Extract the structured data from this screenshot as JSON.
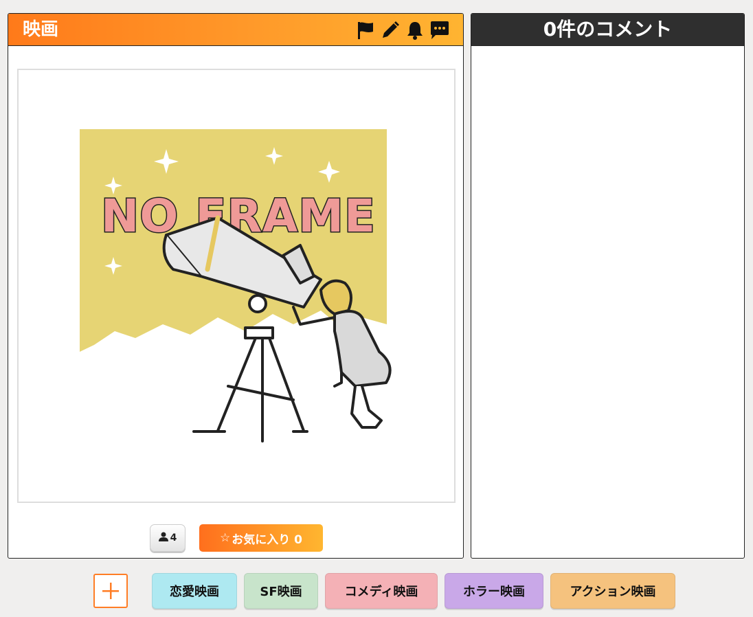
{
  "main": {
    "title": "映画",
    "icons": [
      "flag-icon",
      "pencil-icon",
      "bell-icon",
      "comment-icon"
    ],
    "image": {
      "text": "NO FRAME"
    },
    "viewers": {
      "icon": "user-icon",
      "count": "4"
    },
    "favorite": {
      "star": "☆",
      "label": "お気に入り 0"
    }
  },
  "comments": {
    "title": "0件のコメント"
  },
  "categories": [
    {
      "label": "恋愛映画",
      "color": "#aee9f1"
    },
    {
      "label": "SF映画",
      "color": "#c8e4cb"
    },
    {
      "label": "コメディ映画",
      "color": "#f4b1b6"
    },
    {
      "label": "ホラー映画",
      "color": "#c9a8e8"
    },
    {
      "label": "アクション映画",
      "color": "#f5c27e"
    }
  ],
  "colors": {
    "accent": "#ff7d25",
    "header_dark": "#2f2f2f",
    "image_bg": "#e6d474",
    "logo_pink": "#ef9a97"
  }
}
